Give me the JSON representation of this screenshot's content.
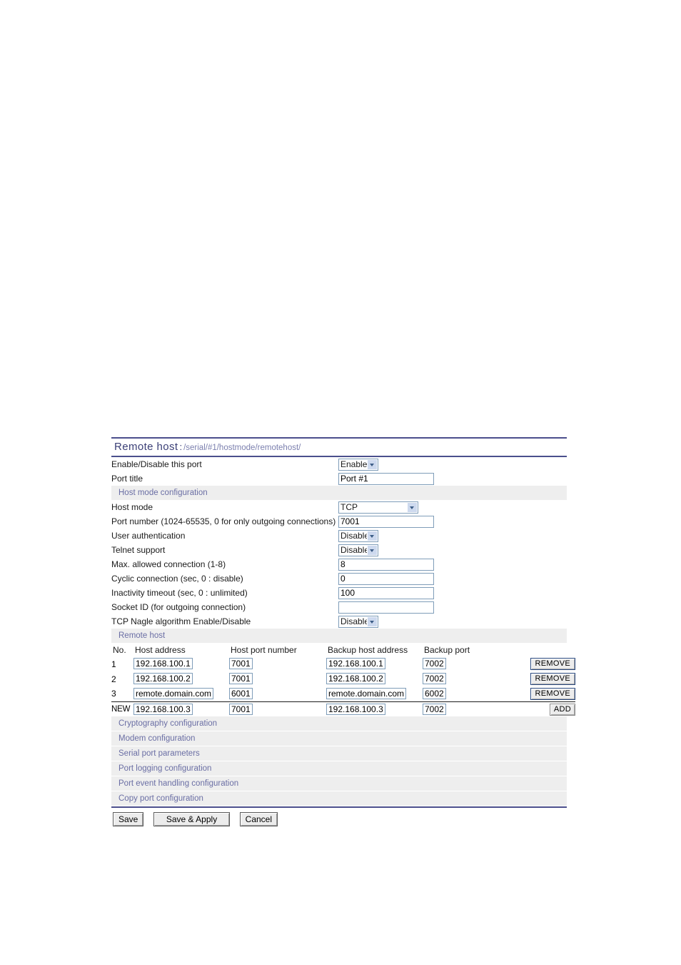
{
  "header": {
    "title": "Remote host",
    "separator": ":",
    "path": "/serial/#1/hostmode/remotehost/"
  },
  "colors": {
    "rule": "#4b4f8c",
    "section_band": "#eeeeee",
    "section_text": "#6a6ea4",
    "input_border": "#7f9db9",
    "title_text": "#3c4077",
    "path_text": "#7b7fae"
  },
  "top_fields": [
    {
      "label": "Enable/Disable this port",
      "control": "select",
      "value": "Enable",
      "size": "small"
    },
    {
      "label": "Port title",
      "control": "text",
      "value": "Port #1",
      "size": "wide"
    }
  ],
  "sections": {
    "hostmode": {
      "label": "Host mode configuration"
    },
    "remotehost": {
      "label": "Remote host"
    }
  },
  "hostmode_fields": [
    {
      "label": "Host mode",
      "control": "select",
      "value": "TCP",
      "size": "large"
    },
    {
      "label": "Port number (1024-65535, 0 for only outgoing connections)",
      "control": "text",
      "value": "7001",
      "size": "wide"
    },
    {
      "label": "User authentication",
      "control": "select",
      "value": "Disable",
      "size": "small"
    },
    {
      "label": "Telnet support",
      "control": "select",
      "value": "Disable",
      "size": "small"
    },
    {
      "label": "Max. allowed connection (1-8)",
      "control": "text",
      "value": "8",
      "size": "wide"
    },
    {
      "label": "Cyclic connection (sec, 0 : disable)",
      "control": "text",
      "value": "0",
      "size": "wide"
    },
    {
      "label": "Inactivity timeout (sec, 0 : unlimited)",
      "control": "text",
      "value": "100",
      "size": "wide"
    },
    {
      "label": "Socket ID (for outgoing connection)",
      "control": "text",
      "value": "",
      "size": "wide"
    },
    {
      "label": "TCP Nagle algorithm Enable/Disable",
      "control": "select",
      "value": "Disable",
      "size": "small"
    }
  ],
  "remote_host_table": {
    "columns": [
      "No.",
      "Host address",
      "Host port number",
      "Backup host address",
      "Backup port"
    ],
    "rows": [
      {
        "no": "1",
        "host_address": "192.168.100.1",
        "host_port": "7001",
        "backup_host_address": "192.168.100.1",
        "backup_port": "7002",
        "action": "REMOVE"
      },
      {
        "no": "2",
        "host_address": "192.168.100.2",
        "host_port": "7001",
        "backup_host_address": "192.168.100.2",
        "backup_port": "7002",
        "action": "REMOVE"
      },
      {
        "no": "3",
        "host_address": "remote.domain.com",
        "host_port": "6001",
        "backup_host_address": "remote.domain.com",
        "backup_port": "6002",
        "action": "REMOVE"
      }
    ],
    "new_row": {
      "no": "NEW",
      "host_address": "192.168.100.3",
      "host_port": "7001",
      "backup_host_address": "192.168.100.3",
      "backup_port": "7002",
      "action": "ADD"
    }
  },
  "link_bands": [
    {
      "label": "Cryptography configuration"
    },
    {
      "label": "Modem configuration"
    },
    {
      "label": "Serial port parameters"
    },
    {
      "label": "Port logging configuration"
    },
    {
      "label": "Port event handling configuration"
    },
    {
      "label": "Copy port configuration"
    }
  ],
  "footer": {
    "save": "Save",
    "save_apply": "Save & Apply",
    "cancel": "Cancel"
  }
}
